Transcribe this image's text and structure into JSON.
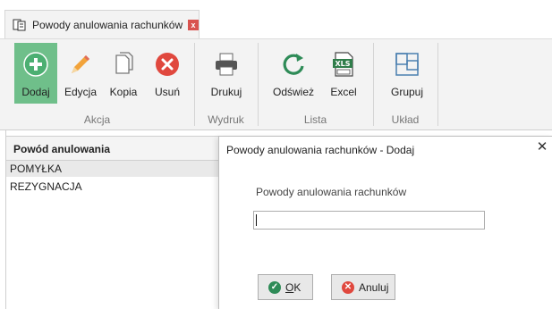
{
  "tab": {
    "title": "Powody anulowania rachunków",
    "close_icon": "close-icon"
  },
  "ribbon": {
    "buttons": [
      {
        "label": "Dodaj",
        "icon": "add-icon"
      },
      {
        "label": "Edycja",
        "icon": "pencil-icon"
      },
      {
        "label": "Kopia",
        "icon": "copy-icon"
      },
      {
        "label": "Usuń",
        "icon": "delete-icon"
      },
      {
        "label": "Drukuj",
        "icon": "printer-icon"
      },
      {
        "label": "Odśwież",
        "icon": "refresh-icon"
      },
      {
        "label": "Excel",
        "icon": "excel-icon"
      },
      {
        "label": "Grupuj",
        "icon": "group-icon"
      }
    ],
    "groups": [
      "Akcja",
      "Wydruk",
      "Lista",
      "Układ"
    ]
  },
  "grid": {
    "header": "Powód anulowania",
    "rows": [
      "POMYŁKA",
      "REZYGNACJA"
    ]
  },
  "dialog": {
    "title": "Powody anulowania rachunków - Dodaj",
    "close_glyph": "✕",
    "field_label": "Powody anulowania rachunków",
    "field_value": "",
    "ok_label": "OK",
    "cancel_label": "Anuluj"
  },
  "colors": {
    "accent": "#6fbf8a",
    "add": "#4caf72",
    "delete": "#e0483e",
    "refresh": "#2e8b57",
    "excel": "#2f7d4a",
    "group": "#4a7fb0"
  }
}
